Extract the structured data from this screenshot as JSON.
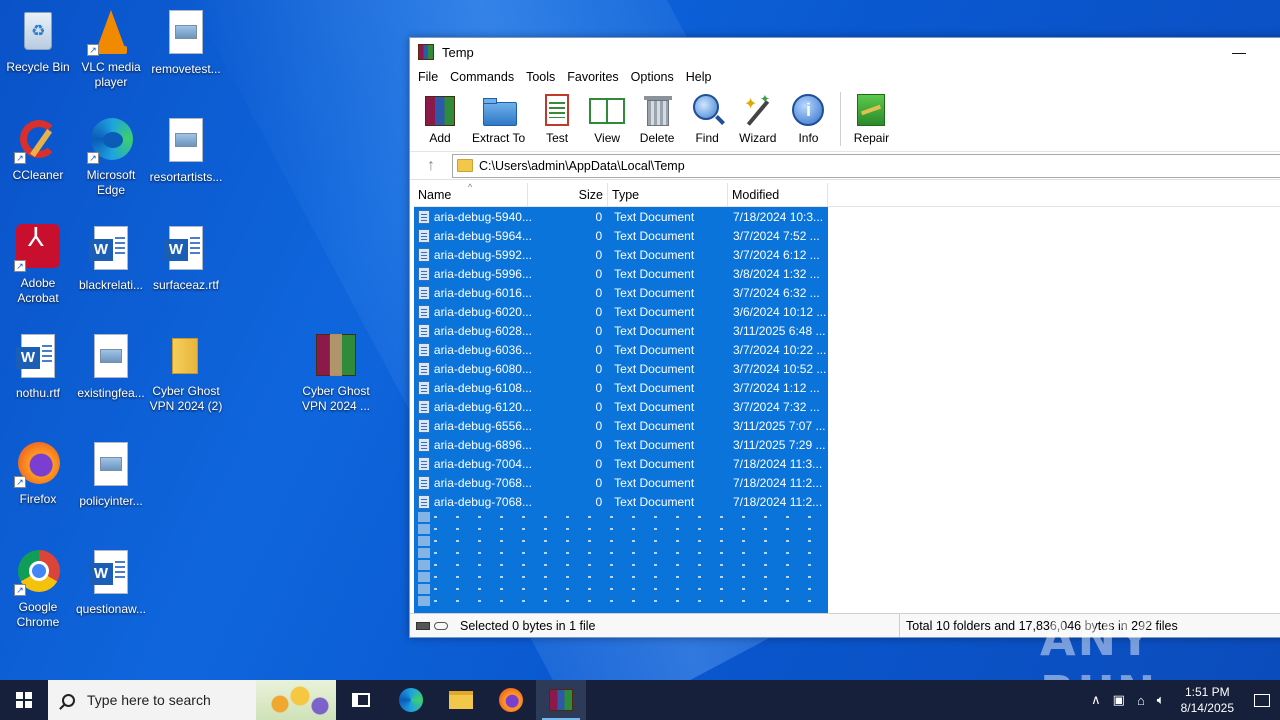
{
  "desktop": {
    "icons": [
      {
        "label": "Recycle Bin"
      },
      {
        "label": "VLC media player"
      },
      {
        "label": "removetest..."
      },
      {
        "label": "CCleaner"
      },
      {
        "label": "Microsoft Edge"
      },
      {
        "label": "resortartists..."
      },
      {
        "label": "Adobe Acrobat"
      },
      {
        "label": "blackrelati..."
      },
      {
        "label": "surfaceaz.rtf"
      },
      {
        "label": "nothu.rtf"
      },
      {
        "label": "existingfea..."
      },
      {
        "label": "Cyber Ghost VPN 2024 (2)"
      },
      {
        "label": "Cyber Ghost VPN 2024 ..."
      },
      {
        "label": "Firefox"
      },
      {
        "label": "policyinter..."
      },
      {
        "label": "Google Chrome"
      },
      {
        "label": "questionaw..."
      }
    ]
  },
  "window": {
    "title": "Temp",
    "menu": [
      "File",
      "Commands",
      "Tools",
      "Favorites",
      "Options",
      "Help"
    ],
    "toolbar": [
      "Add",
      "Extract To",
      "Test",
      "View",
      "Delete",
      "Find",
      "Wizard",
      "Info",
      "Repair"
    ],
    "address": "C:\\Users\\admin\\AppData\\Local\\Temp",
    "columns": {
      "name": "Name",
      "size": "Size",
      "type": "Type",
      "modified": "Modified"
    },
    "files": [
      {
        "name": "aria-debug-5940...",
        "size": "0",
        "type": "Text Document",
        "modified": "7/18/2024 10:3..."
      },
      {
        "name": "aria-debug-5964...",
        "size": "0",
        "type": "Text Document",
        "modified": "3/7/2024 7:52 ..."
      },
      {
        "name": "aria-debug-5992...",
        "size": "0",
        "type": "Text Document",
        "modified": "3/7/2024 6:12 ..."
      },
      {
        "name": "aria-debug-5996...",
        "size": "0",
        "type": "Text Document",
        "modified": "3/8/2024 1:32 ..."
      },
      {
        "name": "aria-debug-6016...",
        "size": "0",
        "type": "Text Document",
        "modified": "3/7/2024 6:32 ..."
      },
      {
        "name": "aria-debug-6020...",
        "size": "0",
        "type": "Text Document",
        "modified": "3/6/2024 10:12 ..."
      },
      {
        "name": "aria-debug-6028...",
        "size": "0",
        "type": "Text Document",
        "modified": "3/11/2025 6:48 ..."
      },
      {
        "name": "aria-debug-6036...",
        "size": "0",
        "type": "Text Document",
        "modified": "3/7/2024 10:22 ..."
      },
      {
        "name": "aria-debug-6080...",
        "size": "0",
        "type": "Text Document",
        "modified": "3/7/2024 10:52 ..."
      },
      {
        "name": "aria-debug-6108...",
        "size": "0",
        "type": "Text Document",
        "modified": "3/7/2024 1:12 ..."
      },
      {
        "name": "aria-debug-6120...",
        "size": "0",
        "type": "Text Document",
        "modified": "3/7/2024 7:32 ..."
      },
      {
        "name": "aria-debug-6556...",
        "size": "0",
        "type": "Text Document",
        "modified": "3/11/2025 7:07 ..."
      },
      {
        "name": "aria-debug-6896...",
        "size": "0",
        "type": "Text Document",
        "modified": "3/11/2025 7:29 ..."
      },
      {
        "name": "aria-debug-7004...",
        "size": "0",
        "type": "Text Document",
        "modified": "7/18/2024 11:3..."
      },
      {
        "name": "aria-debug-7068...",
        "size": "0",
        "type": "Text Document",
        "modified": "7/18/2024 11:2..."
      },
      {
        "name": "aria-debug-7068...",
        "size": "0",
        "type": "Text Document",
        "modified": "7/18/2024 11:2..."
      }
    ],
    "status_left": "Selected 0 bytes in 1 file",
    "status_right": "Total 10 folders and 17,836,046 bytes in 292 files"
  },
  "taskbar": {
    "search_placeholder": "Type here to search",
    "time": "1:51 PM",
    "date": "8/14/2025"
  },
  "watermark": "ANY RUN"
}
